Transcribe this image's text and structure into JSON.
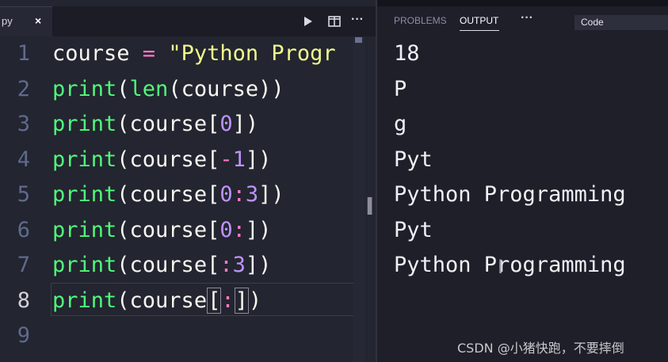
{
  "editor": {
    "tab": {
      "name": "py",
      "close": "×"
    },
    "toolbar": {
      "run_icon": "play-icon",
      "split_icon": "split-editor-icon",
      "more_icon": "more-icon",
      "more": "···"
    },
    "lines": [
      {
        "number": "1",
        "tokens": [
          {
            "t": "course ",
            "c": "p"
          },
          {
            "t": "=",
            "c": "op"
          },
          {
            "t": " \"Python Progr",
            "c": "str"
          }
        ]
      },
      {
        "number": "2",
        "tokens": [
          {
            "t": "print",
            "c": "fn"
          },
          {
            "t": "(",
            "c": "p"
          },
          {
            "t": "len",
            "c": "fn"
          },
          {
            "t": "(course))",
            "c": "p"
          }
        ]
      },
      {
        "number": "3",
        "tokens": [
          {
            "t": "print",
            "c": "fn"
          },
          {
            "t": "(course[",
            "c": "p"
          },
          {
            "t": "0",
            "c": "num"
          },
          {
            "t": "])",
            "c": "p"
          }
        ]
      },
      {
        "number": "4",
        "tokens": [
          {
            "t": "print",
            "c": "fn"
          },
          {
            "t": "(course[",
            "c": "p"
          },
          {
            "t": "-",
            "c": "op"
          },
          {
            "t": "1",
            "c": "num"
          },
          {
            "t": "])",
            "c": "p"
          }
        ]
      },
      {
        "number": "5",
        "tokens": [
          {
            "t": "print",
            "c": "fn"
          },
          {
            "t": "(course[",
            "c": "p"
          },
          {
            "t": "0",
            "c": "num"
          },
          {
            "t": ":",
            "c": "op"
          },
          {
            "t": "3",
            "c": "num"
          },
          {
            "t": "])",
            "c": "p"
          }
        ]
      },
      {
        "number": "6",
        "tokens": [
          {
            "t": "print",
            "c": "fn"
          },
          {
            "t": "(course[",
            "c": "p"
          },
          {
            "t": "0",
            "c": "num"
          },
          {
            "t": ":",
            "c": "op"
          },
          {
            "t": "])",
            "c": "p"
          }
        ]
      },
      {
        "number": "7",
        "tokens": [
          {
            "t": "print",
            "c": "fn"
          },
          {
            "t": "(course[",
            "c": "p"
          },
          {
            "t": ":",
            "c": "op"
          },
          {
            "t": "3",
            "c": "num"
          },
          {
            "t": "])",
            "c": "p"
          }
        ]
      },
      {
        "number": "8",
        "tokens": [
          {
            "t": "print",
            "c": "fn"
          },
          {
            "t": "(course",
            "c": "p"
          },
          {
            "t": "[",
            "c": "p box"
          },
          {
            "t": ":",
            "c": "op"
          },
          {
            "t": "]",
            "c": "p box"
          },
          {
            "t": ")",
            "c": "p"
          }
        ],
        "active": true
      },
      {
        "number": "9",
        "tokens": []
      }
    ]
  },
  "panel": {
    "tabs": [
      "PROBLEMS",
      "OUTPUT"
    ],
    "active_tab": "OUTPUT",
    "more": "···",
    "channel": "Code",
    "output_lines": [
      "18",
      "P",
      "g",
      "Pyt",
      "Python Programming",
      "Pyt",
      "Python Programming"
    ]
  },
  "watermark": "CSDN @小猪快跑，不要摔倒",
  "colors": {
    "function": "#50fa7b",
    "number": "#bd93f9",
    "string": "#f1fa8c",
    "operator": "#ff79c6",
    "background": "#232530"
  }
}
